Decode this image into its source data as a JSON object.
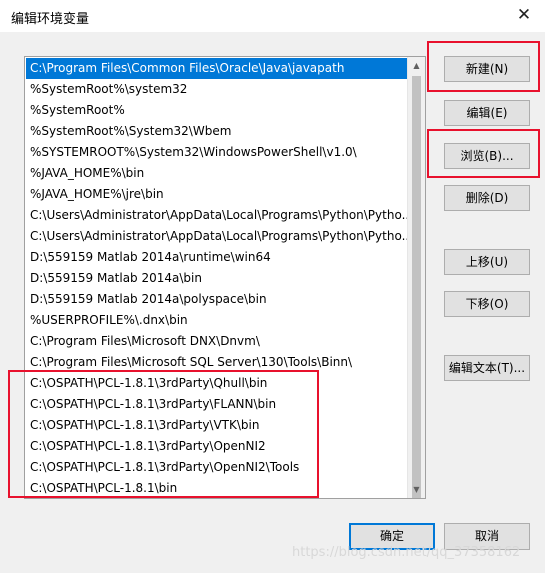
{
  "window": {
    "title": "编辑环境变量",
    "close_glyph": "✕"
  },
  "path_list": [
    "C:\\Program Files\\Common Files\\Oracle\\Java\\javapath",
    "%SystemRoot%\\system32",
    "%SystemRoot%",
    "%SystemRoot%\\System32\\Wbem",
    "%SYSTEMROOT%\\System32\\WindowsPowerShell\\v1.0\\",
    "%JAVA_HOME%\\bin",
    "%JAVA_HOME%\\jre\\bin",
    "C:\\Users\\Administrator\\AppData\\Local\\Programs\\Python\\Pytho...",
    "C:\\Users\\Administrator\\AppData\\Local\\Programs\\Python\\Pytho...",
    "D:\\559159 Matlab 2014a\\runtime\\win64",
    "D:\\559159 Matlab 2014a\\bin",
    "D:\\559159 Matlab 2014a\\polyspace\\bin",
    "%USERPROFILE%\\.dnx\\bin",
    "C:\\Program Files\\Microsoft DNX\\Dnvm\\",
    "C:\\Program Files\\Microsoft SQL Server\\130\\Tools\\Binn\\",
    "C:\\OSPATH\\PCL-1.8.1\\3rdParty\\Qhull\\bin",
    "C:\\OSPATH\\PCL-1.8.1\\3rdParty\\FLANN\\bin",
    "C:\\OSPATH\\PCL-1.8.1\\3rdParty\\VTK\\bin",
    "C:\\OSPATH\\PCL-1.8.1\\3rdParty\\OpenNI2",
    "C:\\OSPATH\\PCL-1.8.1\\3rdParty\\OpenNI2\\Tools",
    "C:\\OSPATH\\PCL-1.8.1\\bin"
  ],
  "selected_index": 0,
  "buttons": {
    "new": "新建(N)",
    "edit": "编辑(E)",
    "browse": "浏览(B)...",
    "delete": "删除(D)",
    "move_up": "上移(U)",
    "move_down": "下移(O)",
    "edit_text": "编辑文本(T)...",
    "ok": "确定",
    "cancel": "取消"
  },
  "scrollbar": {
    "up_glyph": "▲",
    "down_glyph": "▼"
  },
  "watermark": "https://blog.csdn.net/qq_37358162",
  "colors": {
    "selection": "#0078d7",
    "highlight_box": "#e8112d",
    "default_button_border": "#0078d7"
  }
}
